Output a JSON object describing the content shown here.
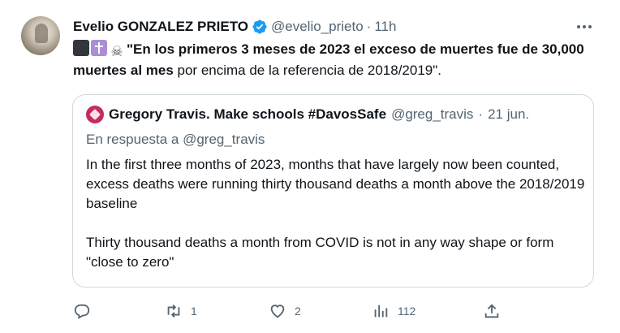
{
  "author": {
    "name": "Evelio GONZALEZ PRIETO",
    "handle": "@evelio_prieto",
    "separator": "·",
    "time": "11h",
    "verified": true
  },
  "tweet": {
    "emojis": [
      "black-square",
      "latin-cross",
      "skull-and-crossbones"
    ],
    "bold_text": "\"En los primeros 3 meses de 2023 el exceso de muertes fue de 30,000 muertes al mes",
    "normal_text": " por encima de la referencia de 2018/2019\"."
  },
  "quoted": {
    "name": "Gregory Travis. Make schools #DavosSafe",
    "handle": "@greg_travis",
    "separator": "·",
    "time": "21 jun.",
    "reply_to": "En respuesta a @greg_travis",
    "paragraph1": "In the first three months of 2023, months that have largely now been counted, excess deaths were running thirty thousand deaths a month above the 2018/2019 baseline",
    "paragraph2": "Thirty thousand deaths a month from COVID is not in any way shape or form \"close to zero\""
  },
  "actions": {
    "reply_count": "",
    "retweet_count": "1",
    "like_count": "2",
    "views_count": "112"
  },
  "colors": {
    "text": "#0f1419",
    "secondary": "#536471",
    "verified": "#1d9bf0",
    "border": "#cfd9de"
  }
}
